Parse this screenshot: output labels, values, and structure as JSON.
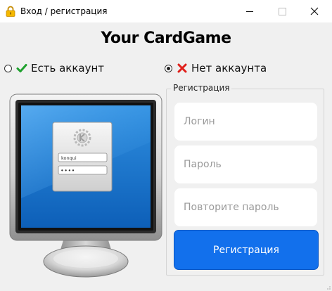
{
  "window": {
    "title": "Вход / регистрация",
    "minimize_icon": "minimize-icon",
    "maximize_icon": "maximize-icon",
    "close_icon": "close-icon",
    "close_glyph": "✕"
  },
  "app": {
    "title": "Your CardGame"
  },
  "mode": {
    "has_account_label": "Есть аккаунт",
    "no_account_label": "Нет аккаунта",
    "selected": "no_account",
    "check_color": "#1fa12e",
    "cross_color": "#e0201b"
  },
  "illustration": {
    "username_text": "konqui",
    "password_mask": "••••"
  },
  "registration": {
    "group_title": "Регистрация",
    "login_placeholder": "Логин",
    "password_placeholder": "Пароль",
    "repeat_password_placeholder": "Повторите пароль",
    "submit_label": "Регистрация",
    "accent_color": "#1270ec"
  }
}
